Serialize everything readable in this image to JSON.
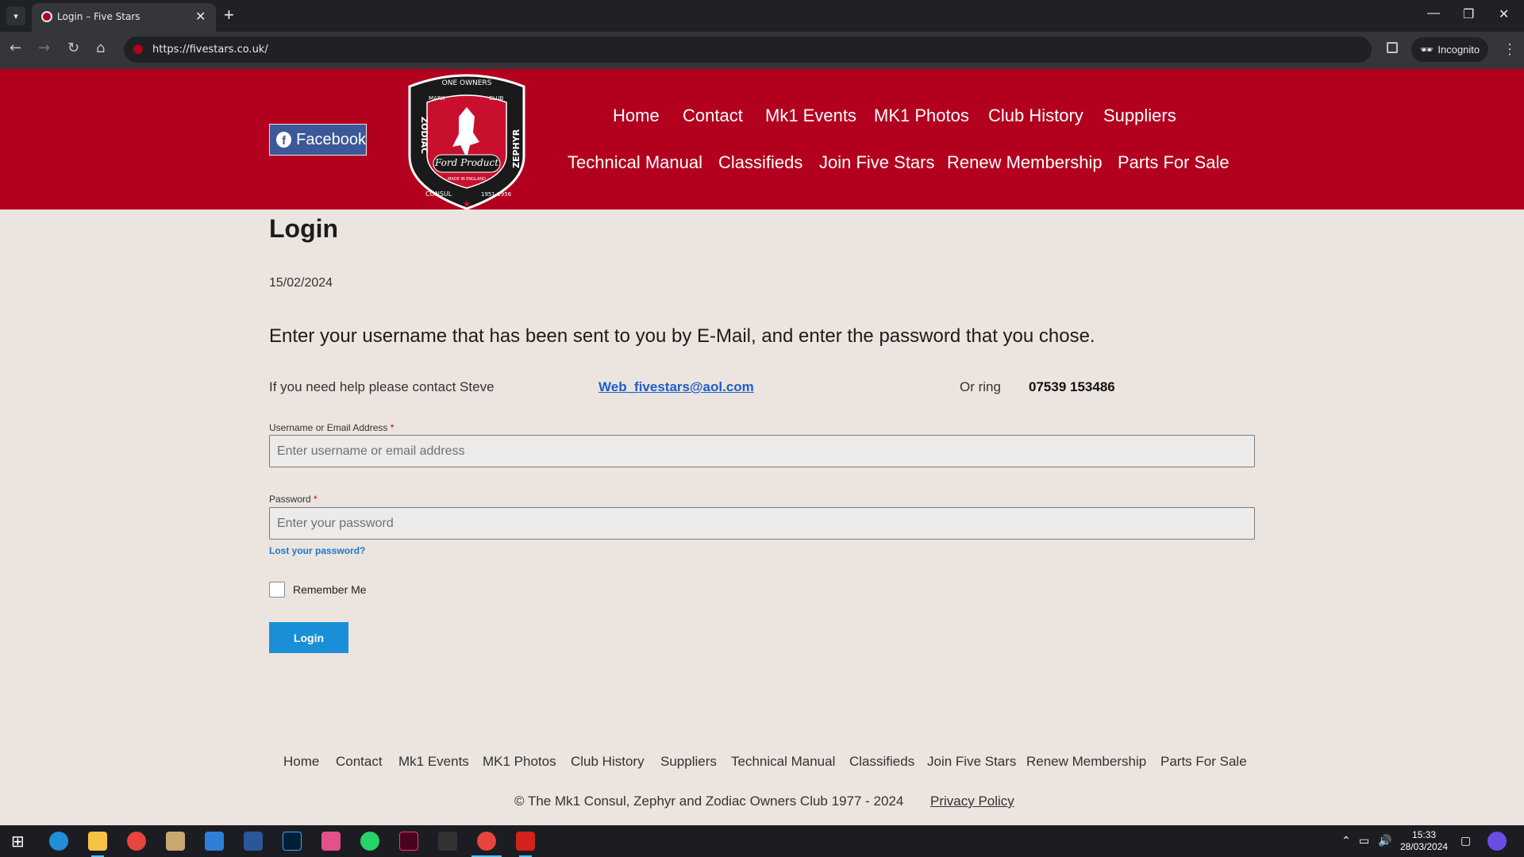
{
  "browser": {
    "tab_title": "Login – Five Stars",
    "url": "https://fivestars.co.uk/",
    "incognito_label": "Incognito"
  },
  "header": {
    "facebook_label": "Facebook",
    "logo_text": {
      "top": "ONE OWNERS",
      "left_top": "MARK",
      "right_top": "CLUB",
      "left": "ZODIAC",
      "right": "ZEPHYR",
      "bottom_left": "CONSUL",
      "bottom_right": "1951-1956",
      "center": "Ford Product",
      "center_small": "MADE IN ENGLAND"
    },
    "nav_row1": [
      "Home",
      "Contact",
      "Mk1 Events",
      "MK1 Photos",
      "Club History",
      "Suppliers"
    ],
    "nav_row2": [
      "Technical Manual",
      "Classifieds",
      "Join Five Stars",
      "Renew Membership",
      "Parts For Sale"
    ]
  },
  "content": {
    "title": "Login",
    "date": "15/02/2024",
    "intro": "Enter your username that has been sent to you by E-Mail, and enter the password that you chose.",
    "help_text": "If you need help please contact Steve",
    "help_email": "Web_fivestars@aol.com",
    "or_ring": "Or ring",
    "phone": "07539 153486"
  },
  "form": {
    "username_label": "Username or Email Address",
    "username_placeholder": "Enter username or email address",
    "password_label": "Password",
    "password_placeholder": "Enter your password",
    "required_mark": "*",
    "lost_password": "Lost your password?",
    "remember_me": "Remember Me",
    "submit_label": "Login"
  },
  "footer": {
    "nav": [
      "Home",
      "Contact",
      "Mk1 Events",
      "MK1 Photos",
      "Club History",
      "Suppliers",
      "Technical Manual",
      "Classifieds",
      "Join Five Stars",
      "Renew Membership",
      "Parts For Sale"
    ],
    "copyright": "© The Mk1 Consul, Zephyr and Zodiac Owners Club 1977 - 2024",
    "privacy": "Privacy Policy"
  },
  "taskbar": {
    "time": "15:33",
    "date": "28/03/2024"
  },
  "colors": {
    "brand_red": "#b3001f",
    "page_bg": "#ebe4df",
    "facebook_blue": "#3b5998",
    "button_blue": "#1a8fd8",
    "link_blue": "#1e5ec8"
  }
}
